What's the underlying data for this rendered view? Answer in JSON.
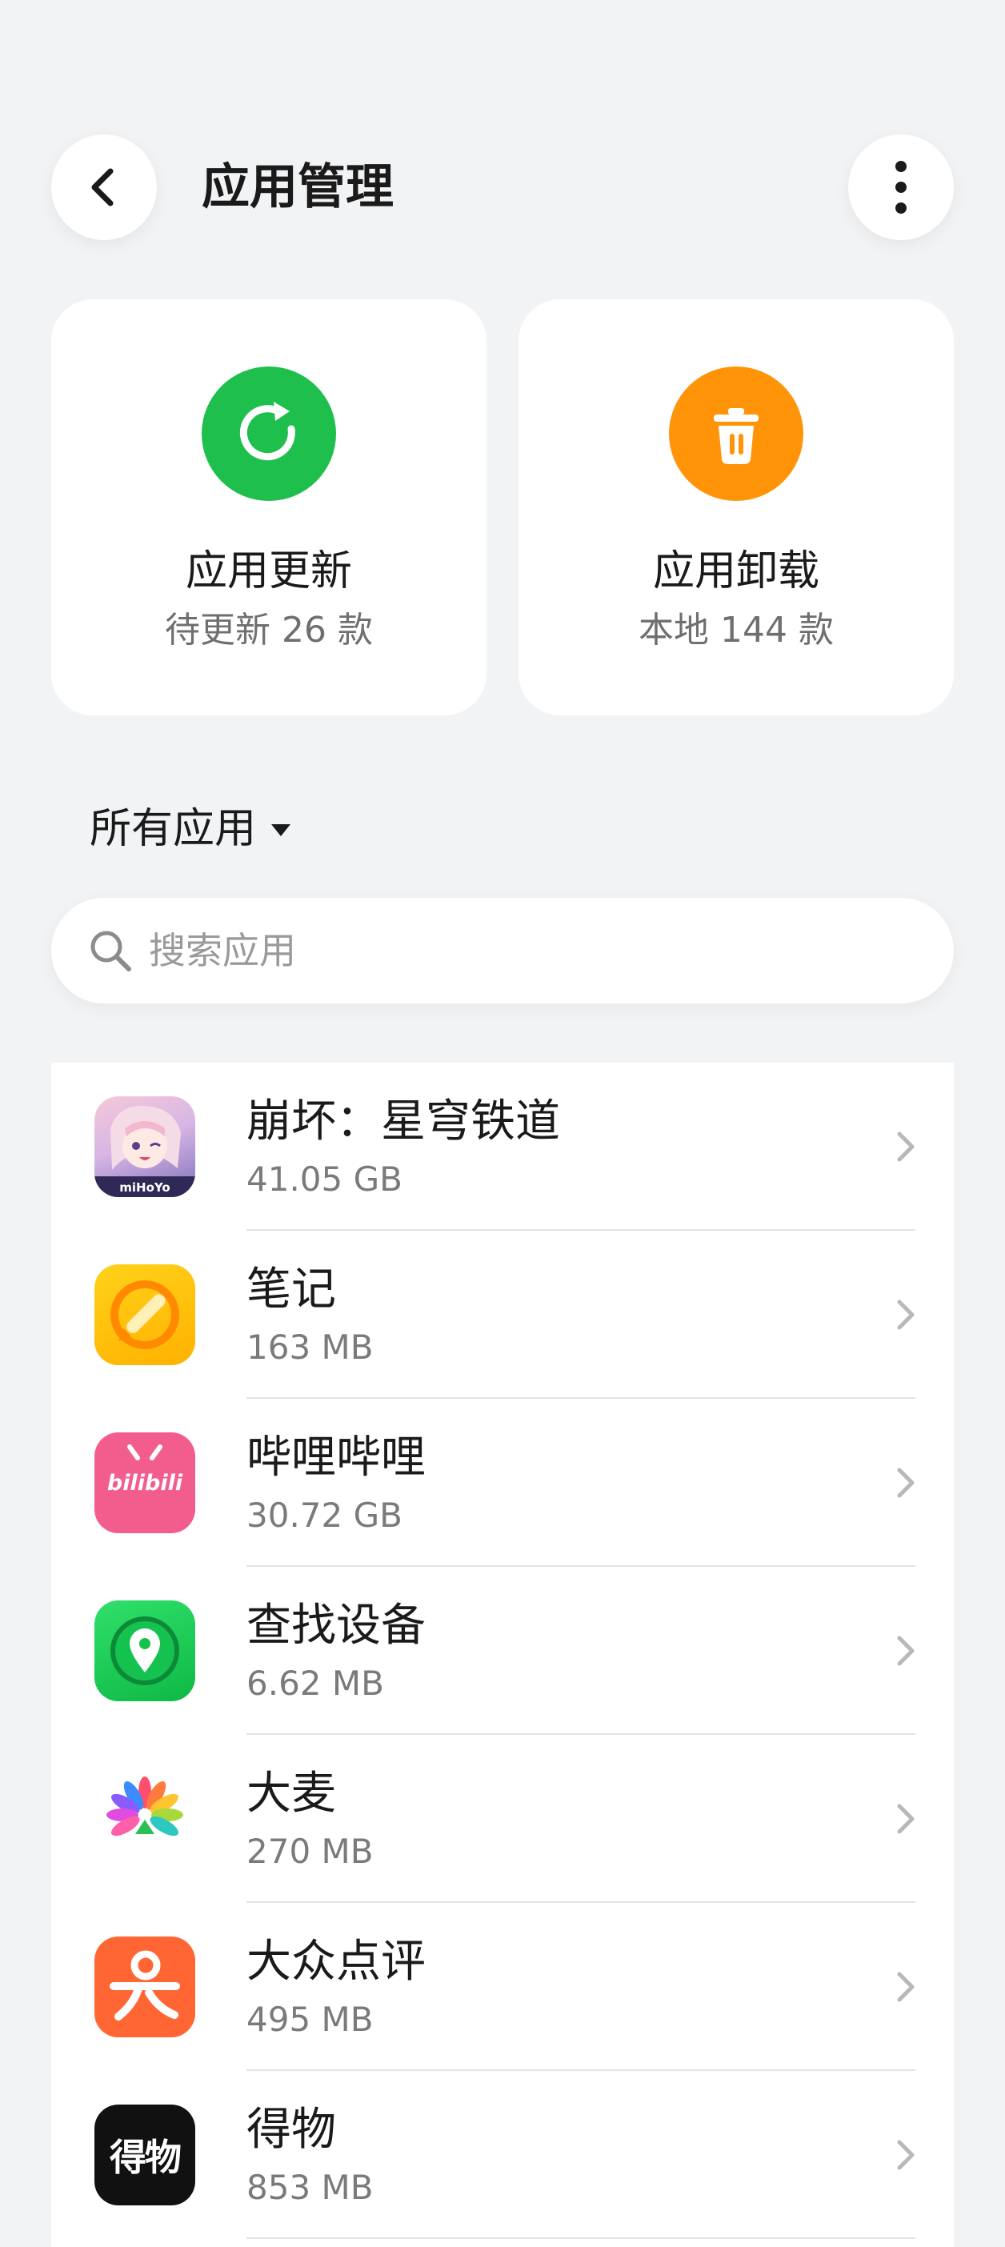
{
  "header": {
    "title": "应用管理",
    "back_icon": "chevron-left-icon",
    "more_icon": "more-vertical-icon"
  },
  "cards": {
    "update": {
      "title": "应用更新",
      "subtitle": "待更新 26 款",
      "icon": "refresh-icon",
      "color": "#1fbf4d"
    },
    "uninstall": {
      "title": "应用卸载",
      "subtitle": "本地 144 款",
      "icon": "trash-icon",
      "color": "#ff9408"
    }
  },
  "filter": {
    "label": "所有应用",
    "icon": "caret-down-icon"
  },
  "search": {
    "placeholder": "搜索应用",
    "value": "",
    "icon": "search-icon"
  },
  "apps": [
    {
      "name": "崩坏：星穹铁道",
      "size": "41.05 GB",
      "icon": "honkai-star-rail-icon",
      "icon_text": "miHoYo"
    },
    {
      "name": "笔记",
      "size": "163 MB",
      "icon": "notes-icon"
    },
    {
      "name": "哔哩哔哩",
      "size": "30.72 GB",
      "icon": "bilibili-icon",
      "icon_text": "bilibili"
    },
    {
      "name": "查找设备",
      "size": "6.62 MB",
      "icon": "find-device-icon"
    },
    {
      "name": "大麦",
      "size": "270 MB",
      "icon": "damai-icon"
    },
    {
      "name": "大众点评",
      "size": "495 MB",
      "icon": "dianping-icon"
    },
    {
      "name": "得物",
      "size": "853 MB",
      "icon": "dewu-icon",
      "icon_text": "得物"
    }
  ]
}
